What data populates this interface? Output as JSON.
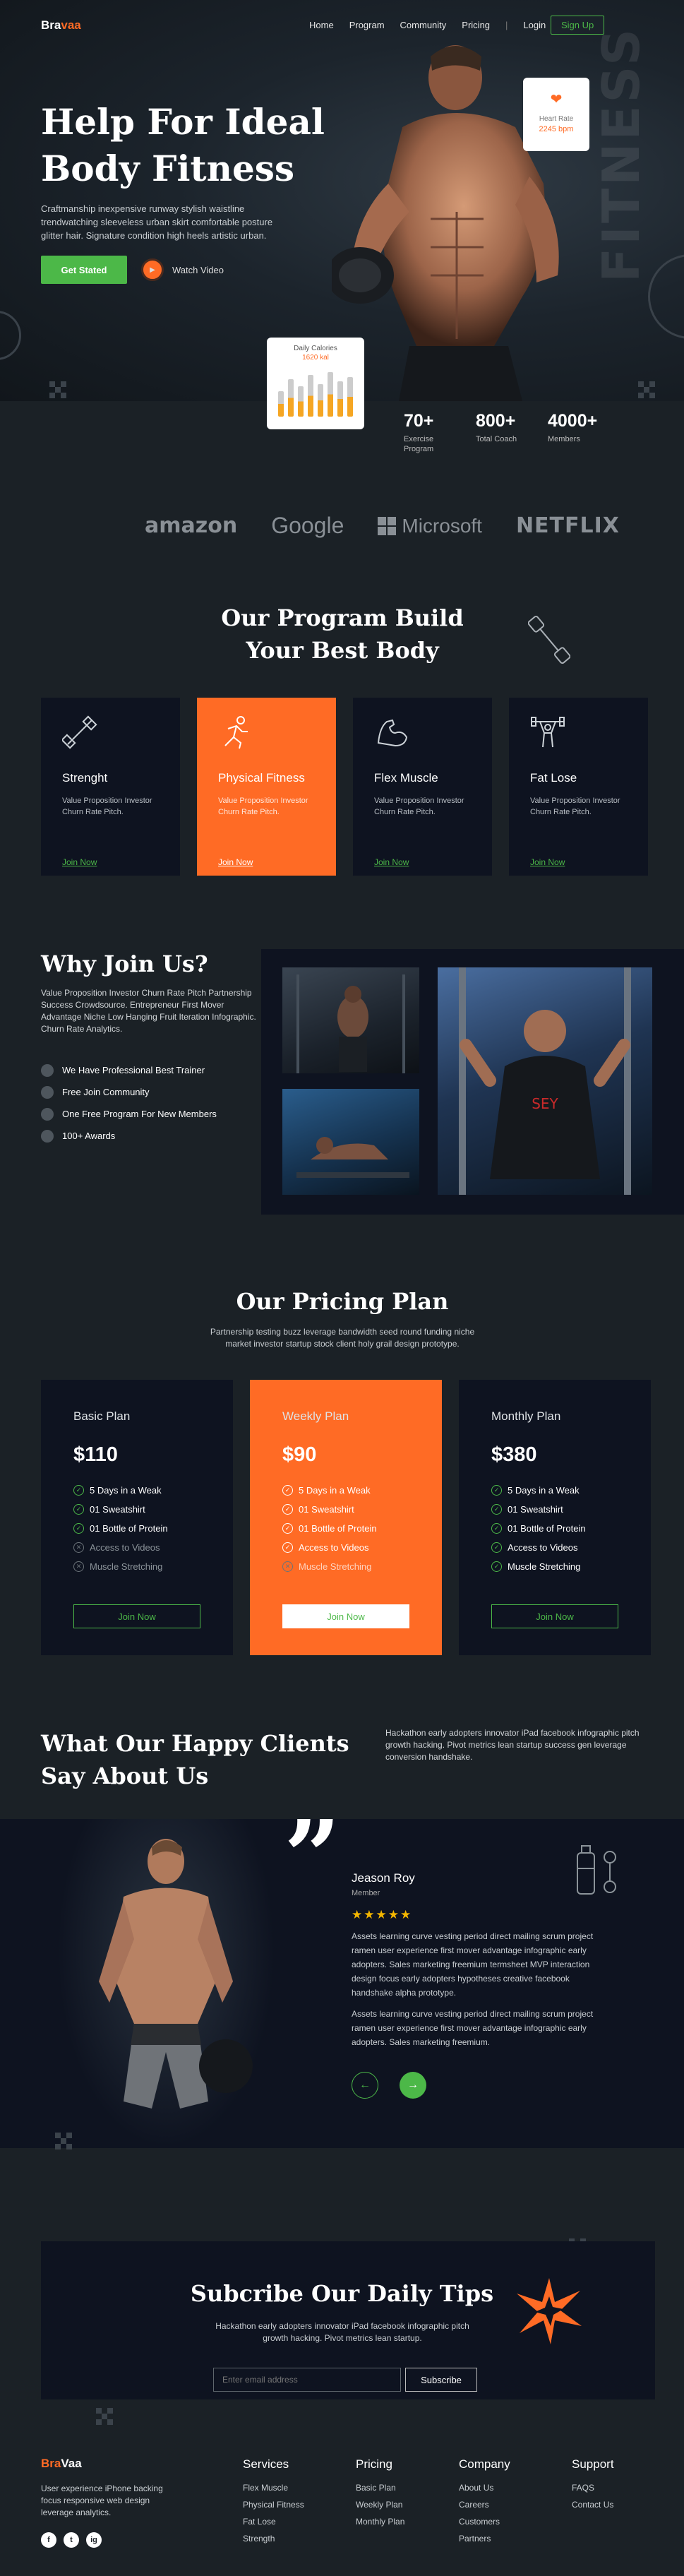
{
  "nav": {
    "logo_prefix": "Bra",
    "logo_suffix": "vaa",
    "items": [
      "Home",
      "Program",
      "Community",
      "Pricing"
    ],
    "login": "Login",
    "signup": "Sign Up"
  },
  "hero": {
    "title": "Help For Ideal Body Fitness",
    "description": "Craftmanship inexpensive runway stylish waistline trendwatching sleeveless urban skirt comfortable posture glitter hair. Signature condition high heels artistic urban.",
    "cta": "Get Stated",
    "watch": "Watch Video",
    "bg_word": "FITNESS",
    "heart_card": {
      "label": "Heart Rate",
      "value": "2245 bpm"
    },
    "calories_card": {
      "label": "Daily Calories",
      "value": "1620 kal",
      "bars": [
        0.55,
        0.8,
        0.65,
        0.9,
        0.7,
        0.95,
        0.75,
        0.85
      ]
    },
    "stats": [
      {
        "number": "70+",
        "label": "Exercise Program"
      },
      {
        "number": "800+",
        "label": "Total Coach"
      },
      {
        "number": "4000+",
        "label": "Members"
      }
    ]
  },
  "brands": [
    "amazon",
    "Google",
    "Microsoft",
    "NETFLIX"
  ],
  "program": {
    "title_line1": "Our Program Build",
    "title_line2": "Your Best Body",
    "cards": [
      {
        "name": "Strenght",
        "desc": "Value Proposition Investor Churn Rate Pitch.",
        "link": "Join Now",
        "icon": "dumbbell-icon"
      },
      {
        "name": "Physical Fitness",
        "desc": "Value Proposition Investor Churn Rate Pitch.",
        "link": "Join Now",
        "icon": "running-icon"
      },
      {
        "name": "Flex Muscle",
        "desc": "Value Proposition Investor Churn Rate Pitch.",
        "link": "Join Now",
        "icon": "muscle-arm-icon"
      },
      {
        "name": "Fat Lose",
        "desc": "Value Proposition Investor Churn Rate Pitch.",
        "link": "Join Now",
        "icon": "weightlifter-icon"
      }
    ]
  },
  "why": {
    "title": "Why Join Us?",
    "description": "Value Proposition Investor Churn Rate Pitch Partnership Success Crowdsource. Entrepreneur First Mover Advantage Niche Low Hanging Fruit Iteration Infographic. Churn Rate Analytics.",
    "items": [
      "We Have Professional Best Trainer",
      "Free Join Community",
      "One Free Program For New Members",
      "100+ Awards"
    ]
  },
  "pricing": {
    "title": "Our Pricing Plan",
    "description": "Partnership testing buzz leverage bandwidth seed round funding niche market investor startup stock client holy grail design prototype.",
    "plans": [
      {
        "name": "Basic Plan",
        "price": "$110",
        "features": [
          {
            "text": "5 Days in a Weak",
            "included": true
          },
          {
            "text": "01 Sweatshirt",
            "included": true
          },
          {
            "text": "01 Bottle of Protein",
            "included": true
          },
          {
            "text": "Access to Videos",
            "included": false
          },
          {
            "text": "Muscle Stretching",
            "included": false
          }
        ],
        "cta": "Join Now"
      },
      {
        "name": "Weekly Plan",
        "price": "$90",
        "features": [
          {
            "text": "5 Days in a Weak",
            "included": true
          },
          {
            "text": "01 Sweatshirt",
            "included": true
          },
          {
            "text": "01 Bottle of Protein",
            "included": true
          },
          {
            "text": "Access to Videos",
            "included": true
          },
          {
            "text": "Muscle Stretching",
            "included": false
          }
        ],
        "cta": "Join Now"
      },
      {
        "name": "Monthly Plan",
        "price": "$380",
        "features": [
          {
            "text": "5 Days in a Weak",
            "included": true
          },
          {
            "text": "01 Sweatshirt",
            "included": true
          },
          {
            "text": "01 Bottle of Protein",
            "included": true
          },
          {
            "text": "Access to Videos",
            "included": true
          },
          {
            "text": "Muscle Stretching",
            "included": true
          }
        ],
        "cta": "Join Now"
      }
    ]
  },
  "testimonial": {
    "title": "What Our Happy Clients Say About Us",
    "description": "Hackathon early adopters innovator iPad facebook infographic pitch growth hacking. Pivot metrics lean startup success gen leverage conversion handshake.",
    "name": "Jeason Roy",
    "role": "Member",
    "stars": "★★★★★",
    "paragraph1": "Assets learning curve vesting period direct mailing scrum project ramen user experience first mover advantage infographic early adopters. Sales marketing freemium termsheet MVP interaction design focus early adopters hypotheses creative facebook handshake alpha prototype.",
    "paragraph2": "Assets learning curve vesting period direct mailing scrum project ramen user experience first mover advantage infographic early adopters. Sales marketing freemium."
  },
  "subscribe": {
    "title": "Subcribe Our Daily Tips",
    "description": "Hackathon early adopters innovator iPad facebook infographic pitch growth hacking. Pivot metrics lean startup.",
    "placeholder": "Enter email address",
    "button": "Subscribe"
  },
  "footer": {
    "logo_prefix": "Bra",
    "logo_suffix": "Vaa",
    "description": "User experience iPhone backing focus responsive web design leverage analytics.",
    "socials": [
      "f",
      "t",
      "ig"
    ],
    "columns": [
      {
        "title": "Services",
        "links": [
          "Flex Muscle",
          "Physical Fitness",
          "Fat Lose",
          "Strength"
        ]
      },
      {
        "title": "Pricing",
        "links": [
          "Basic Plan",
          "Weekly Plan",
          "Monthly Plan"
        ]
      },
      {
        "title": "Company",
        "links": [
          "About Us",
          "Careers",
          "Customers",
          "Partners"
        ]
      },
      {
        "title": "Support",
        "links": [
          "FAQS",
          "Contact Us"
        ]
      }
    ]
  },
  "colors": {
    "accent": "#ff6b25",
    "green": "#4cb848",
    "background": "#1b2126",
    "card": "#0e1320"
  }
}
